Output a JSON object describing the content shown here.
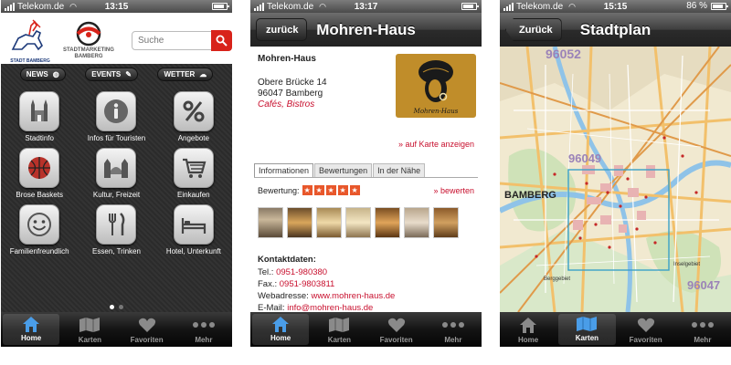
{
  "phones": [
    {
      "status": {
        "carrier": "Telekom.de",
        "time": "13:15"
      },
      "header": {
        "logo_stadt": "STADT BAMBERG",
        "logo_sm_line1": "STADTMARKETING",
        "logo_sm_line2": "BAMBERG",
        "search_placeholder": "Suche"
      },
      "pills": [
        {
          "label": "NEWS",
          "icon": "globe-icon"
        },
        {
          "label": "EVENTS",
          "icon": "pin-icon"
        },
        {
          "label": "WETTER",
          "icon": "weather-icon"
        }
      ],
      "grid": [
        {
          "label": "Stadtinfo",
          "icon": "cathedral-icon"
        },
        {
          "label": "Infos für Touristen",
          "icon": "info-icon"
        },
        {
          "label": "Angebote",
          "icon": "percent-icon"
        },
        {
          "label": "Brose Baskets",
          "icon": "basketball-icon"
        },
        {
          "label": "Kultur, Freizeit",
          "icon": "bridge-icon"
        },
        {
          "label": "Einkaufen",
          "icon": "cart-icon"
        },
        {
          "label": "Familienfreundlich",
          "icon": "smiley-icon"
        },
        {
          "label": "Essen, Trinken",
          "icon": "cutlery-icon"
        },
        {
          "label": "Hotel, Unterkunft",
          "icon": "bed-icon"
        }
      ],
      "page_dots": {
        "count": 2,
        "active": 1
      },
      "active_tab": 0
    },
    {
      "status": {
        "carrier": "Telekom.de",
        "time": "13:17"
      },
      "nav": {
        "back": "zurück",
        "title": "Mohren-Haus"
      },
      "name": "Mohren-Haus",
      "address_line1": "Obere Brücke 14",
      "address_line2": "96047 Bamberg",
      "category": "Cafés, Bistros",
      "logo_text": "Mohren-Haus",
      "map_link": "» auf Karte anzeigen",
      "tabs": [
        "Informationen",
        "Bewertungen",
        "In der Nähe"
      ],
      "rating_label": "Bewertung:",
      "rating_stars": 5,
      "rate_link": "» bewerten",
      "contact_heading": "Kontaktdaten:",
      "tel_label": "Tel.:",
      "tel": "0951-980380",
      "fax_label": "Fax.:",
      "fax": "0951-9803811",
      "web_label": "Webadresse:",
      "web": "www.mohren-haus.de",
      "mail_label": "E-Mail:",
      "mail": "info@mohren-haus.de",
      "active_tab": 0
    },
    {
      "status": {
        "carrier": "Telekom.de",
        "time": "15:15",
        "battery": "86 %"
      },
      "nav": {
        "back": "Zurück",
        "title": "Stadtplan"
      },
      "map_labels": {
        "city": "BAMBERG",
        "postcode1": "96052",
        "postcode2": "96049",
        "postcode3": "96047",
        "area1": "Berggebiet",
        "area2": "Inselgebiet"
      },
      "active_tab": 1
    }
  ],
  "tabbar": [
    "Home",
    "Karten",
    "Favoriten",
    "Mehr"
  ],
  "colors": {
    "accent_red": "#c8102e",
    "star_orange": "#e8572b",
    "search_red": "#d8231a",
    "logo_gold": "#c08d2a"
  }
}
